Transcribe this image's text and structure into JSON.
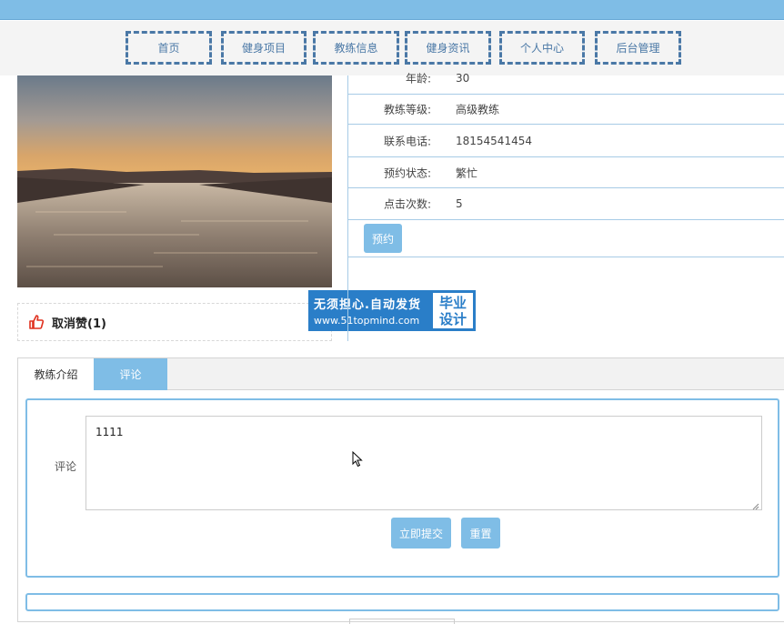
{
  "nav": {
    "items": [
      {
        "label": "首页"
      },
      {
        "label": "健身项目"
      },
      {
        "label": "教练信息"
      },
      {
        "label": "健身资讯"
      },
      {
        "label": "个人中心"
      },
      {
        "label": "后台管理"
      }
    ]
  },
  "like": {
    "label": "取消赞(1)"
  },
  "watermark": {
    "line1": "无须担心.自动发货",
    "line2": "www.51topmind.com",
    "right1": "毕业",
    "right2": "设计"
  },
  "info": {
    "rows": [
      {
        "label": "年龄:",
        "value": "30"
      },
      {
        "label": "教练等级:",
        "value": "高级教练"
      },
      {
        "label": "联系电话:",
        "value": "18154541454"
      },
      {
        "label": "预约状态:",
        "value": "繁忙"
      },
      {
        "label": "点击次数:",
        "value": "5"
      }
    ],
    "book_button": "预约"
  },
  "tabs": {
    "intro": "教练介绍",
    "comment": "评论"
  },
  "comment_form": {
    "label": "评论",
    "value": "1111",
    "submit": "立即提交",
    "reset": "重置"
  },
  "colors": {
    "accent": "#7fbde6",
    "nav_border": "#4a78a6",
    "like_icon": "#e0301e",
    "watermark": "#2a7ec8"
  }
}
